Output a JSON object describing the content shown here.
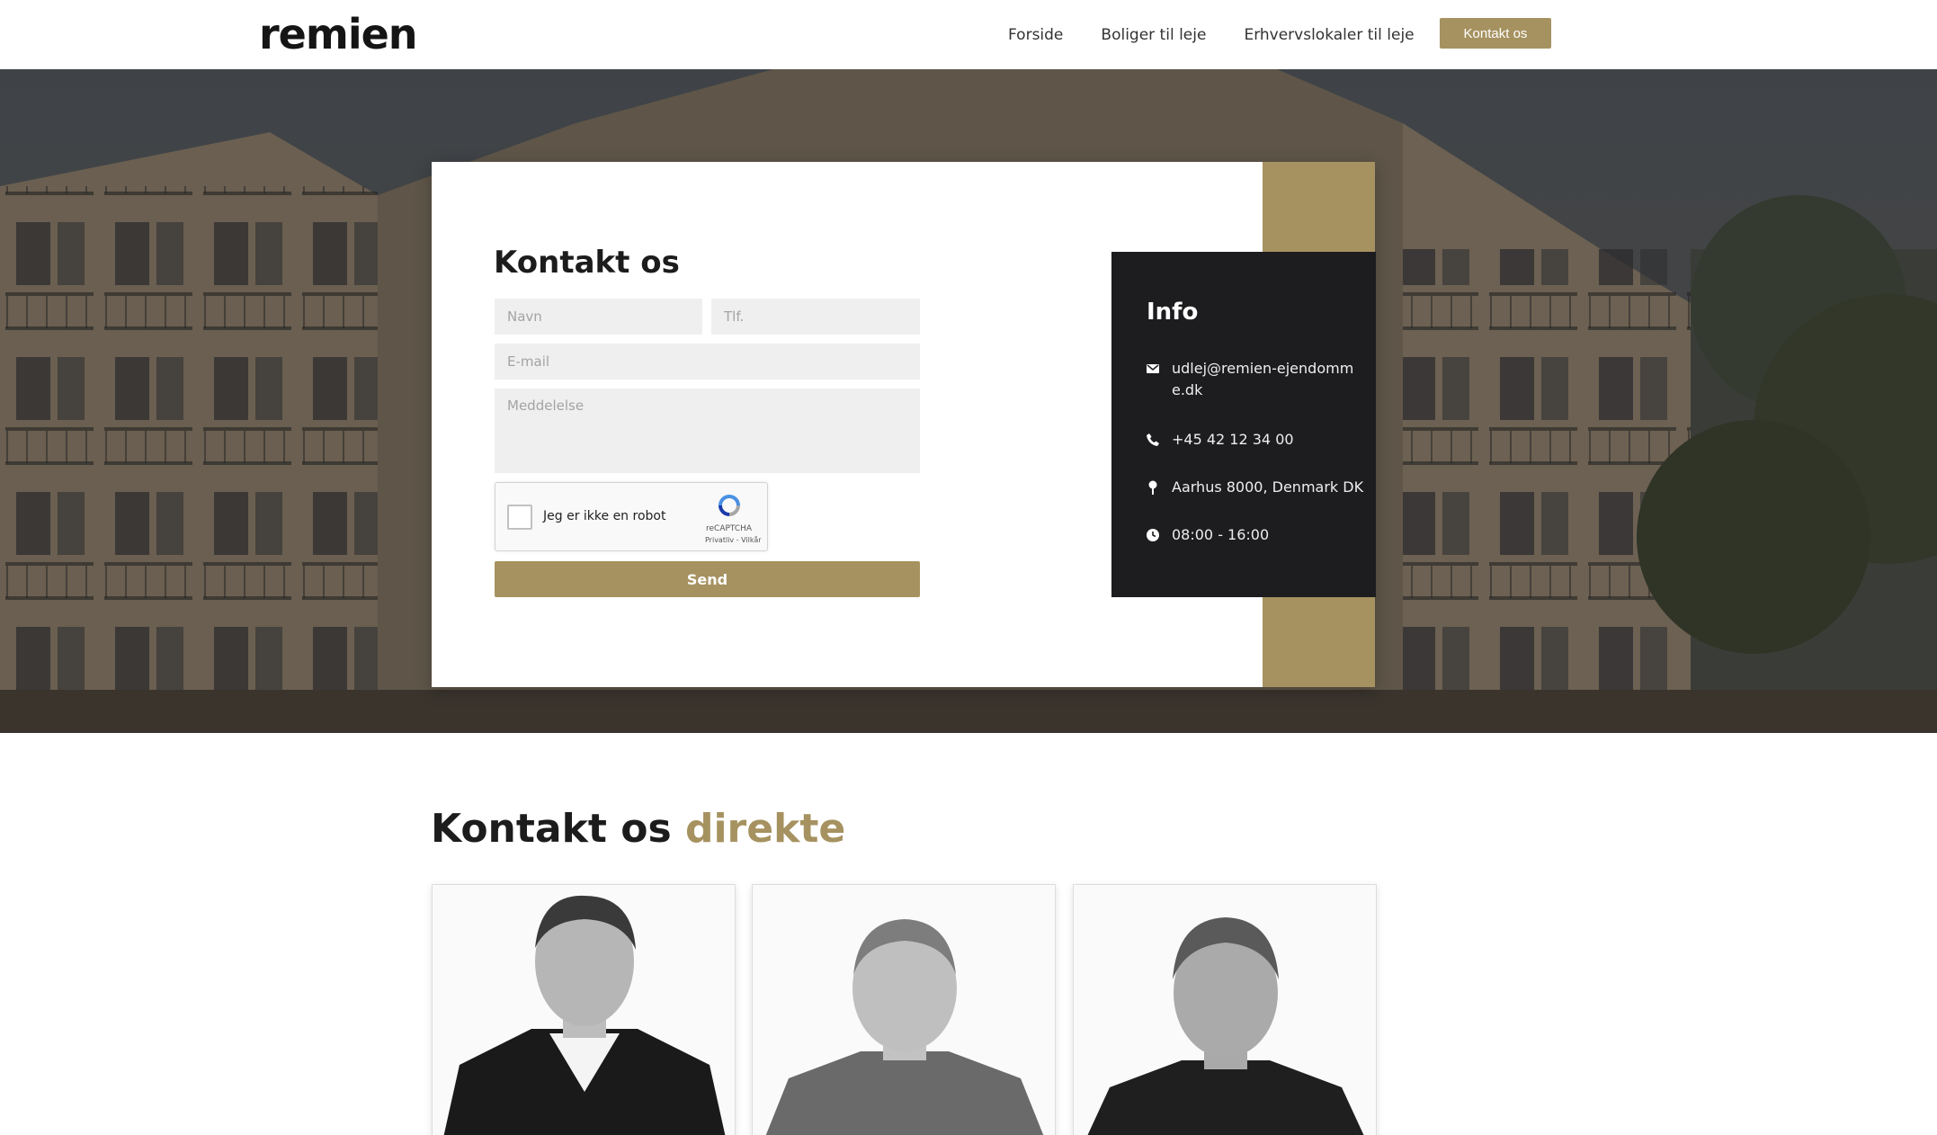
{
  "nav": {
    "logo": "remien",
    "links": [
      "Forside",
      "Boliger til leje",
      "Erhvervslokaler til leje"
    ],
    "cta": "Kontakt os"
  },
  "form": {
    "title": "Kontakt os",
    "placeholders": {
      "name": "Navn",
      "phone": "Tlf.",
      "email": "E-mail",
      "message": "Meddelelse"
    },
    "captcha": {
      "label": "Jeg er ikke en robot",
      "brand": "reCAPTCHA",
      "links": "Privatliv - Vilkår"
    },
    "send": "Send"
  },
  "info": {
    "title": "Info",
    "email": "udlej@remien-ejendomme.dk",
    "phone": "+45 42 12 34 00",
    "address": "Aarhus 8000, Denmark DK",
    "hours": "08:00 - 16:00"
  },
  "direct": {
    "title_main": "Kontakt os",
    "title_accent": "direkte"
  },
  "colors": {
    "accent": "#a69260",
    "dark": "#1d1d1f"
  },
  "icons": [
    "envelope-icon",
    "phone-icon",
    "location-pin-icon",
    "clock-icon",
    "recaptcha-icon"
  ]
}
